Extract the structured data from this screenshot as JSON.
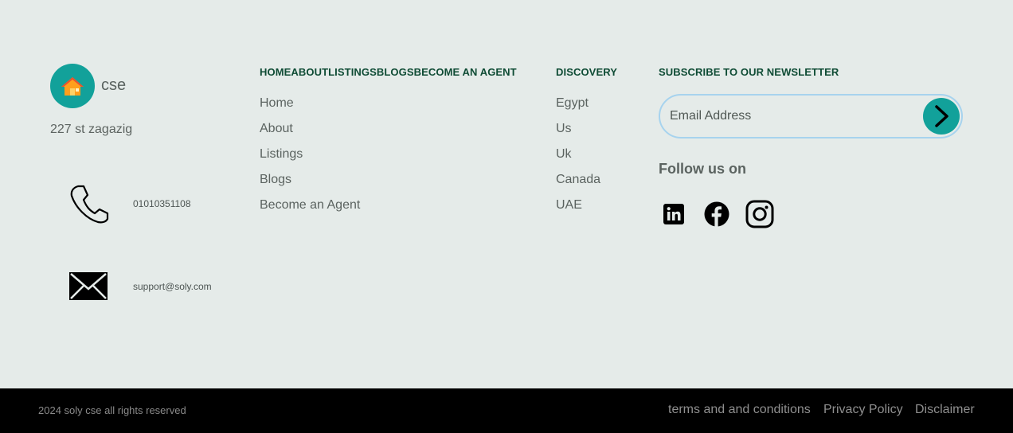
{
  "brand": {
    "name": "cse",
    "address": "227 st zagazig",
    "logo_icon": "house-icon",
    "logo_color": "#12a19a"
  },
  "contact": {
    "phone": {
      "icon": "phone-icon",
      "value": "01010351108"
    },
    "email": {
      "icon": "envelope-icon",
      "value": "support@soly.com"
    }
  },
  "nav_column": {
    "heading_items": [
      "HOME",
      "ABOUT",
      "LISTINGS",
      "BLOGS",
      "BECOME AN AGENT"
    ],
    "links": [
      "Home",
      "About",
      "Listings",
      "Blogs",
      "Become an Agent"
    ]
  },
  "discovery": {
    "heading": "DISCOVERY",
    "links": [
      "Egypt",
      "Us",
      "Uk",
      "Canada",
      "UAE"
    ]
  },
  "newsletter": {
    "heading": "SUBSCRIBE TO OUR NEWSLETTER",
    "placeholder": "Email Address",
    "submit_icon": "chevron-right-icon",
    "follow_label": "Follow us on",
    "socials": [
      "linkedin-icon",
      "facebook-icon",
      "instagram-icon"
    ]
  },
  "bottom": {
    "copyright": "2024 soly cse all rights reserved",
    "links": [
      "terms and and conditions",
      "Privacy Policy",
      "Disclaimer"
    ]
  },
  "colors": {
    "heading": "#0e4b34",
    "accent": "#12a19a",
    "background": "#e5ebe9",
    "bottom_bar": "#000000"
  }
}
